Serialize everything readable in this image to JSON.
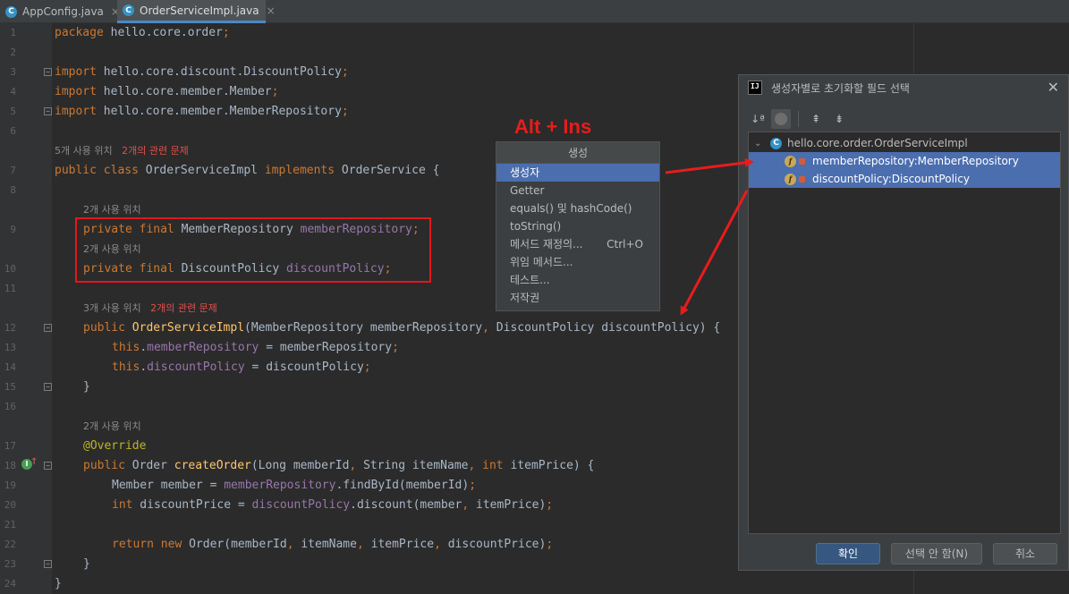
{
  "tabs": [
    {
      "icon": "C",
      "label": "AppConfig.java",
      "close": "×"
    },
    {
      "icon": "C",
      "label": "OrderServiceImpl.java",
      "close": "×"
    }
  ],
  "line_numbers": [
    "1",
    "2",
    "3",
    "4",
    "5",
    "6",
    "7",
    "8",
    "9",
    "10",
    "11",
    "12",
    "13",
    "14",
    "15",
    "16",
    "17",
    "18",
    "19",
    "20",
    "21",
    "22",
    "23",
    "24"
  ],
  "fold_marks": {
    "minus": "−"
  },
  "code": {
    "l1_kw": "package",
    "l1_rest": " hello.core.order",
    "l1_semi": ";",
    "l3_kw": "import",
    "l3_rest": " hello.core.discount.DiscountPolicy",
    "l3_semi": ";",
    "l4_kw": "import",
    "l4_rest": " hello.core.member.Member",
    "l4_semi": ";",
    "l5_kw": "import",
    "l5_rest": " hello.core.member.MemberRepository",
    "l5_semi": ";",
    "l7_kw1": "public class",
    "l7_name": " OrderServiceImpl ",
    "l7_kw2": "implements",
    "l7_rest": " OrderService {",
    "l9_kw": "private final",
    "l9_type": " MemberRepository ",
    "l9_fld": "memberRepository",
    "l9_semi": ";",
    "l10_kw": "private final",
    "l10_type": " DiscountPolicy ",
    "l10_fld": "discountPolicy",
    "l10_semi": ";",
    "l12_kw": "public",
    "l12_fn": " OrderServiceImpl",
    "l12_a": "(MemberRepository memberRepository",
    "l12_c": ",",
    "l12_b": " DiscountPolicy discountPolicy) {",
    "l13_kw": "this",
    "l13_dot": ".",
    "l13_fld": "memberRepository",
    "l13_rest": " = memberRepository",
    "l13_semi": ";",
    "l14_kw": "this",
    "l14_dot": ".",
    "l14_fld": "discountPolicy",
    "l14_rest": " = discountPolicy",
    "l14_semi": ";",
    "l15": "}",
    "l17_ann": "@Override",
    "l18_kw": "public",
    "l18_type": " Order ",
    "l18_fn": "createOrder",
    "l18_a": "(Long memberId",
    "l18_c1": ",",
    "l18_b": " String itemName",
    "l18_c2": ",",
    "l18_kw2": " int",
    "l18_d": " itemPrice) {",
    "l19_a": "Member member = ",
    "l19_fld": "memberRepository",
    "l19_b": ".findById(memberId)",
    "l19_semi": ";",
    "l20_kw": "int",
    "l20_a": " discountPrice = ",
    "l20_fld": "discountPolicy",
    "l20_b": ".discount(member",
    "l20_c": ",",
    "l20_d": " itemPrice)",
    "l20_semi": ";",
    "l22_kw": "return new",
    "l22_a": " Order(memberId",
    "l22_c1": ",",
    "l22_b": " itemName",
    "l22_c2": ",",
    "l22_d": " itemPrice",
    "l22_c3": ",",
    "l22_e": " discountPrice)",
    "l22_semi": ";",
    "l23": "}",
    "l24": "}"
  },
  "hints": {
    "class_usages": "5개 사용 위치",
    "class_problems": "2개의 관련 문제",
    "field1_usages": "2개 사용 위치",
    "field2_usages": "2개 사용 위치",
    "ctor_usages": "3개 사용 위치",
    "ctor_problems": "2개의 관련 문제",
    "method_usages": "2개 사용 위치"
  },
  "gutter_icons": {
    "impl_icon": "I",
    "up_arrow": "↑"
  },
  "annotation_label": "Alt + Ins",
  "generate_popup": {
    "title": "생성",
    "items": [
      {
        "label": "생성자",
        "shortcut": ""
      },
      {
        "label": "Getter",
        "shortcut": ""
      },
      {
        "label": "equals() 및 hashCode()",
        "shortcut": ""
      },
      {
        "label": "toString()",
        "shortcut": ""
      },
      {
        "label": "메서드 재정의...",
        "shortcut": "Ctrl+O"
      },
      {
        "label": "위임 메서드...",
        "shortcut": ""
      },
      {
        "label": "테스트...",
        "shortcut": ""
      },
      {
        "label": "저작권",
        "shortcut": ""
      }
    ],
    "selected_index": 0
  },
  "dialog": {
    "logo": "IJ",
    "title": "생성자별로 초기화할 필드 선택",
    "close": "✕",
    "toolbar": {
      "sort_icon": "↓ª",
      "expand_icon": "⇞",
      "collapse_icon": "⇟"
    },
    "tree": {
      "root_chevron": "⌄",
      "root_icon": "C",
      "root_label": "hello.core.order.OrderServiceImpl",
      "field_icon": "f",
      "fields": [
        "memberRepository:MemberRepository",
        "discountPolicy:DiscountPolicy"
      ]
    },
    "buttons": {
      "ok": "확인",
      "none": "선택 안 함(N)",
      "cancel": "취소"
    }
  },
  "colors": {
    "arrow": "#e81c1c",
    "selection": "#4b6eaf",
    "highlight_box": "#e0181b"
  }
}
